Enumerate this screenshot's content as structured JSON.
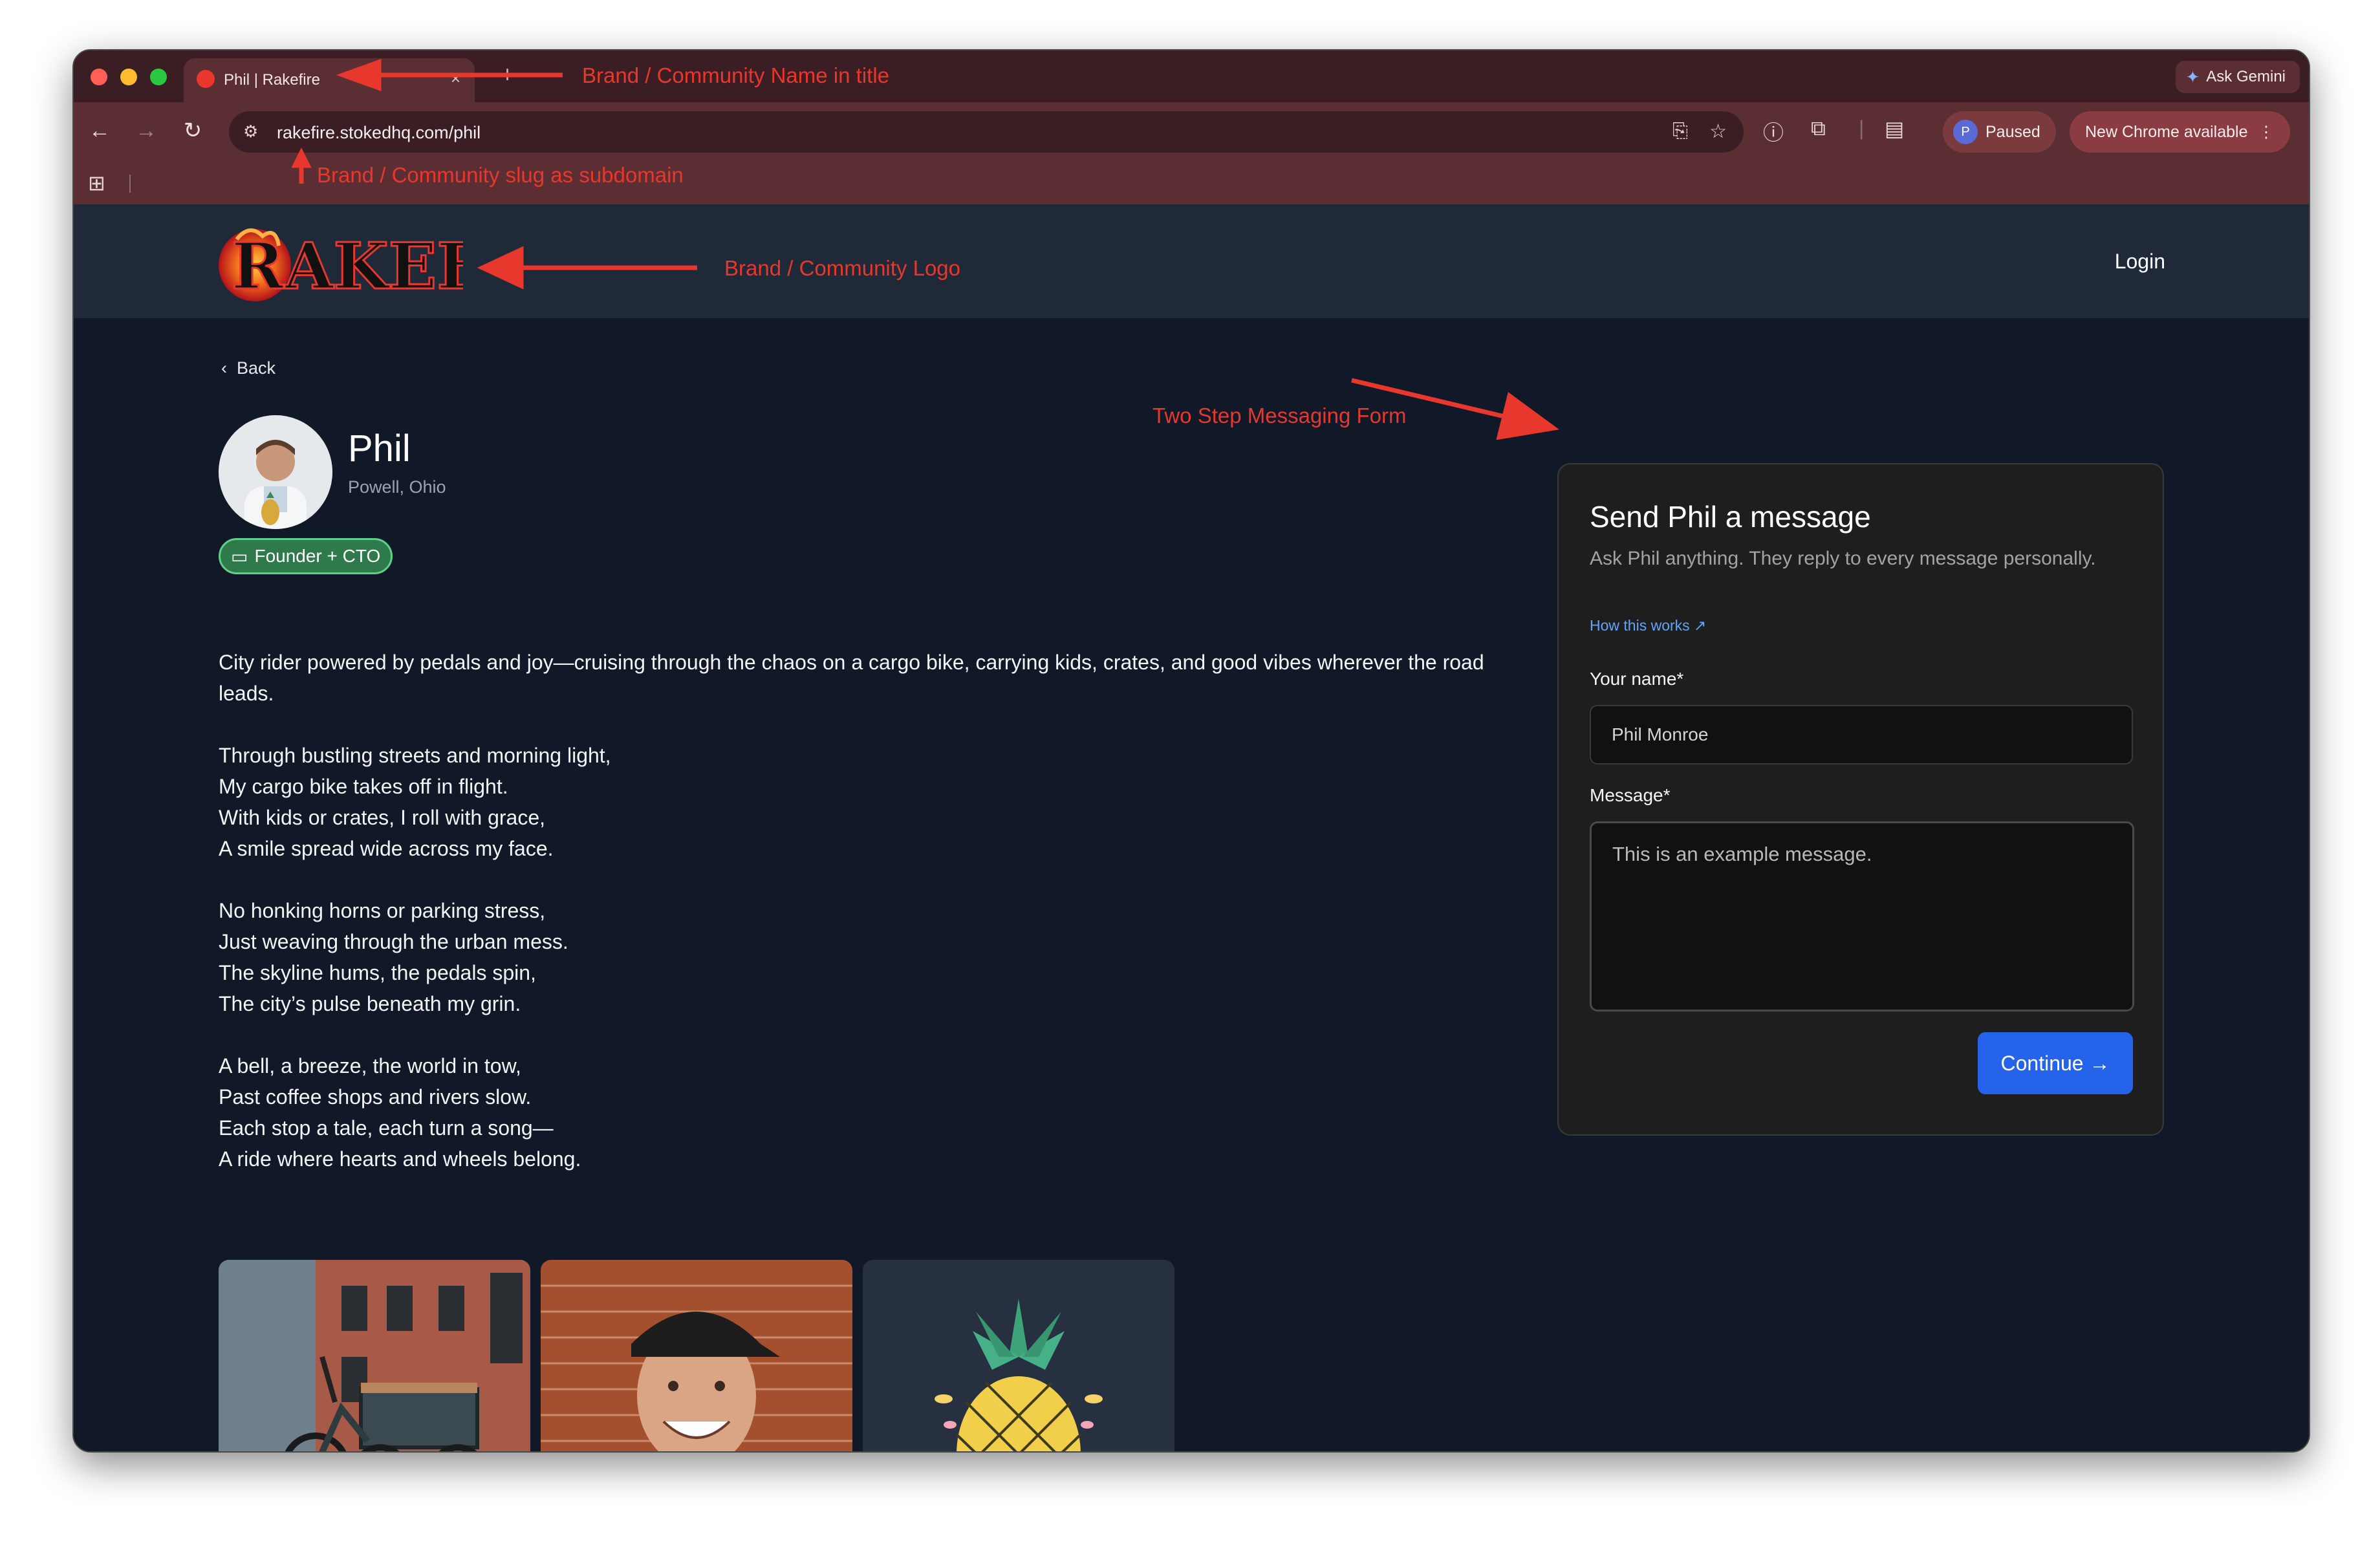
{
  "browser": {
    "tab_title": "Phil | Rakefire",
    "tab_close": "×",
    "new_tab": "+",
    "ask_gemini": "Ask Gemini",
    "url": "rakefire.stokedhq.com/phil",
    "profile_initial": "P",
    "profile_status": "Paused",
    "update_label": "New Chrome available"
  },
  "site": {
    "logo_text": "RAKEFIRE",
    "login_label": "Login"
  },
  "profile": {
    "back_label": "Back",
    "name": "Phil",
    "location": "Powell, Ohio",
    "role": "Founder + CTO",
    "bio": [
      "City rider powered by pedals and joy—cruising through the chaos on a cargo bike, carrying kids, crates, and good vibes wherever the road leads.",
      "Through bustling streets and morning light,\nMy cargo bike takes off in flight.\nWith kids or crates, I roll with grace,\nA smile spread wide across my face.",
      "No honking horns or parking stress,\nJust weaving through the urban mess.\nThe skyline hums, the pedals spin,\nThe city’s pulse beneath my grin.",
      "A bell, a breeze, the world in tow,\nPast coffee shops and rivers slow.\nEach stop a tale, each turn a song—\nA ride where hearts and wheels belong."
    ]
  },
  "form": {
    "title": "Send Phil a message",
    "subtitle": "Ask Phil anything. They reply to every message personally.",
    "how_link": "How this works ↗",
    "name_label": "Your name*",
    "name_value": "Phil Monroe",
    "message_label": "Message*",
    "message_value": "This is an example message.",
    "continue_label": "Continue →"
  },
  "annotations": {
    "title": "Brand / Community Name in title",
    "subdomain": "Brand / Community slug as subdomain",
    "logo": "Brand / Community Logo",
    "form": "Two Step Messaging Form"
  },
  "colors": {
    "annotation": "#e8372c",
    "primary_button": "#2563eb",
    "page_bg": "#111827",
    "header_bg": "#1f2937",
    "badge_green": "#2f7a4b"
  }
}
